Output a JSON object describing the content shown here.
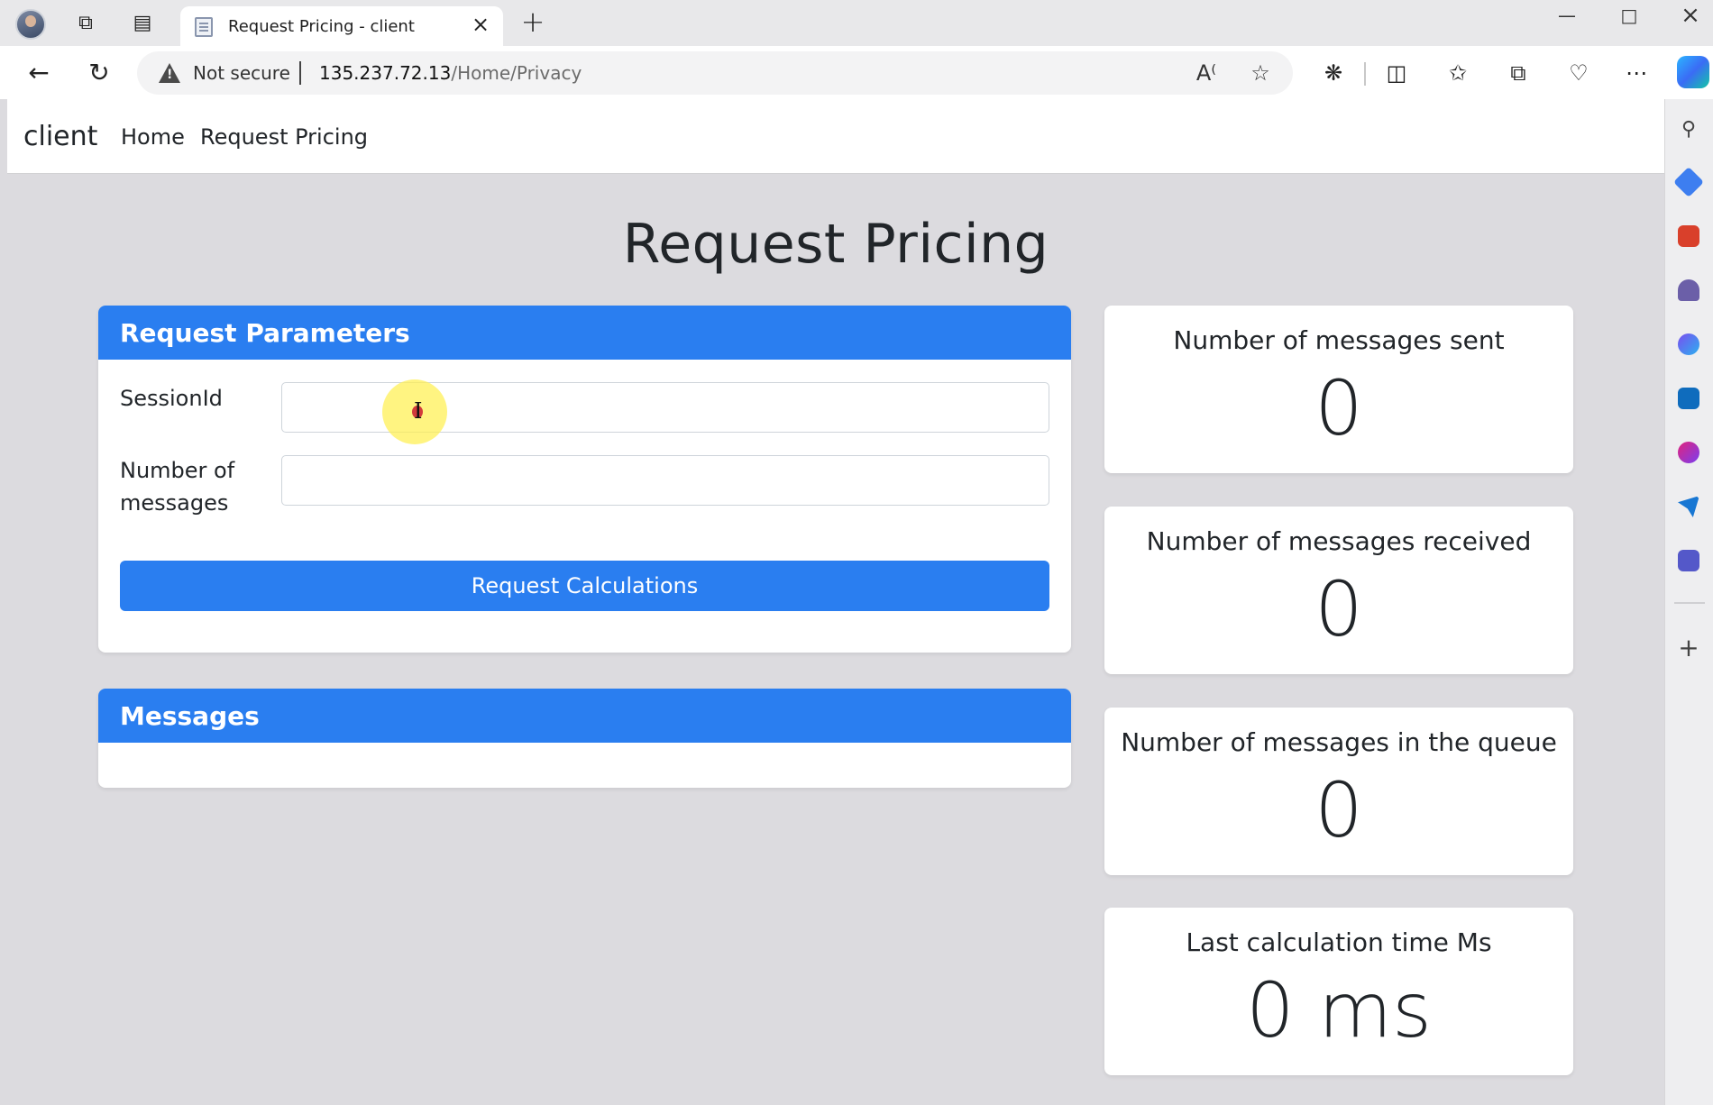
{
  "browser": {
    "tab_title": "Request Pricing - client",
    "new_tab_symbol": "+",
    "security_label": "Not secure",
    "url_host": "135.237.72.13",
    "url_path": "/Home/Privacy"
  },
  "navbar": {
    "brand": "client",
    "links": [
      "Home",
      "Request Pricing"
    ]
  },
  "page": {
    "title": "Request Pricing"
  },
  "request_parameters": {
    "header": "Request Parameters",
    "session_label": "SessionId",
    "session_value": "",
    "messages_label_line1": "Number of",
    "messages_label_line2": "messages",
    "messages_value": "",
    "submit_label": "Request Calculations"
  },
  "messages_panel": {
    "header": "Messages"
  },
  "stats": [
    {
      "label": "Number of messages sent",
      "value": "0"
    },
    {
      "label": "Number of messages received",
      "value": "0"
    },
    {
      "label": "Number of messages in the queue",
      "value": "0"
    },
    {
      "label": "Last calculation time Ms",
      "value": "0 ms"
    }
  ],
  "colors": {
    "primary": "#2a7ef0",
    "page_background": "#dcdbdf",
    "cursor_highlight": "#fff050"
  }
}
